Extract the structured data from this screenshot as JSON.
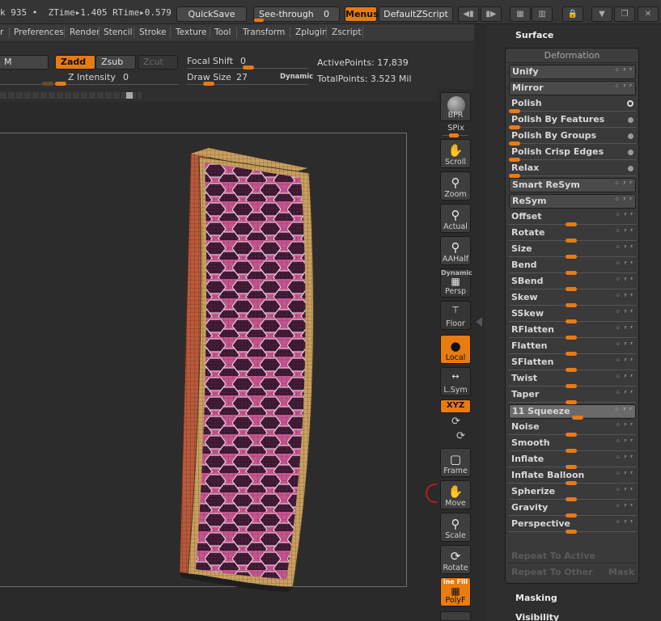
{
  "status": {
    "text": "k 935 •  ZTime▸1.405 RTime▸0.579"
  },
  "topbar": {
    "quicksave": "QuickSave",
    "see_through_label": "See-through",
    "see_through_value": "0",
    "menus": "Menus",
    "default_zscript": "DefaultZScript"
  },
  "menubar": [
    "r",
    "Preferences",
    "Render",
    "Stencil",
    "Stroke",
    "Texture",
    "Tool",
    "Transform",
    "Zplugin",
    "Zscript"
  ],
  "toolrow": {
    "m_label": "M",
    "zadd": "Zadd",
    "zsub": "Zsub",
    "zcut": "Zcut",
    "z_intensity_label": "Z Intensity",
    "z_intensity_value": "0",
    "focal_shift_label": "Focal Shift",
    "focal_shift_value": "0",
    "draw_size_label": "Draw Size",
    "draw_size_value": "27",
    "dynamic": "Dynamic",
    "active_points": "ActivePoints: 17,839",
    "total_points": "TotalPoints: 3.523 Mil"
  },
  "shelf": {
    "bpr": "BPR",
    "spix": "SPix",
    "scroll": "Scroll",
    "zoom": "Zoom",
    "actual": "Actual",
    "aahalf": "AAHalf",
    "dynamic": "Dynamic",
    "persp": "Persp",
    "floor": "Floor",
    "local": "Local",
    "lsym": "L.Sym",
    "xyz": "XYZ",
    "frame": "Frame",
    "move": "Move",
    "scale": "Scale",
    "rotate": "Rotate",
    "line_fill": "ine Fill",
    "polyf": "PolyF"
  },
  "panel": {
    "surface": "Surface",
    "deformation": "Deformation",
    "masking": "Masking",
    "visibility": "Visibility",
    "rows": [
      {
        "label": "Unify",
        "axis": "xyz",
        "boxed": true
      },
      {
        "label": "Mirror",
        "axis": "xyz",
        "boxed": true
      },
      {
        "label": "Polish",
        "dot": "ring",
        "slider": 0.0
      },
      {
        "label": "Polish By Features",
        "dot": "dot",
        "slider": 0.0
      },
      {
        "label": "Polish By Groups",
        "dot": "dot",
        "slider": 0.0
      },
      {
        "label": "Polish Crisp Edges",
        "dot": "dot",
        "slider": 0.0
      },
      {
        "label": "Relax",
        "dot": "dot",
        "slider": 0.0
      },
      {
        "label": "Smart ReSym",
        "axis": "xyz",
        "boxed": true
      },
      {
        "label": "ReSym",
        "axis": "xyz",
        "boxed": true
      },
      {
        "label": "Offset",
        "axis": "xyz",
        "slider": 0.5
      },
      {
        "label": "Rotate",
        "axis": "xyz",
        "slider": 0.5
      },
      {
        "label": "Size",
        "axis": "xyz",
        "slider": 0.5
      },
      {
        "label": "Bend",
        "axis": "xyz",
        "slider": 0.5
      },
      {
        "label": "SBend",
        "axis": "xyz",
        "slider": 0.5
      },
      {
        "label": "Skew",
        "axis": "xyz",
        "slider": 0.5
      },
      {
        "label": "SSkew",
        "axis": "xyz",
        "slider": 0.5
      },
      {
        "label": "RFlatten",
        "axis": "xyz",
        "slider": 0.5
      },
      {
        "label": "Flatten",
        "axis": "xyz",
        "slider": 0.5
      },
      {
        "label": "SFlatten",
        "axis": "xyz",
        "slider": 0.5
      },
      {
        "label": "Twist",
        "axis": "xyz",
        "slider": 0.5
      },
      {
        "label": "Taper",
        "axis": "xyz",
        "slider": 0.5
      },
      {
        "label": "11 Squeeze",
        "axis": "xyz",
        "slider": 0.55,
        "highlight": true
      },
      {
        "label": "Noise",
        "axis": "xyz",
        "slider": 0.5
      },
      {
        "label": "Smooth",
        "axis": "xyz",
        "slider": 0.5
      },
      {
        "label": "Inflate",
        "axis": "xyz",
        "slider": 0.5
      },
      {
        "label": "Inflate Balloon",
        "axis": "xyz",
        "slider": 0.5
      },
      {
        "label": "Spherize",
        "axis": "xyz",
        "slider": 0.5
      },
      {
        "label": "Gravity",
        "axis": "xyz",
        "slider": 0.5
      },
      {
        "label": "Perspective",
        "axis": "xyz",
        "slider": 0.5
      }
    ],
    "repeat_active": "Repeat To Active",
    "repeat_other": "Repeat To Other",
    "mask": "Mask"
  },
  "colors": {
    "accent": "#e87b12",
    "mesh_pink": "#c4568e",
    "mesh_tan": "#c8a060",
    "panel_bg": "#3a3a3a"
  }
}
